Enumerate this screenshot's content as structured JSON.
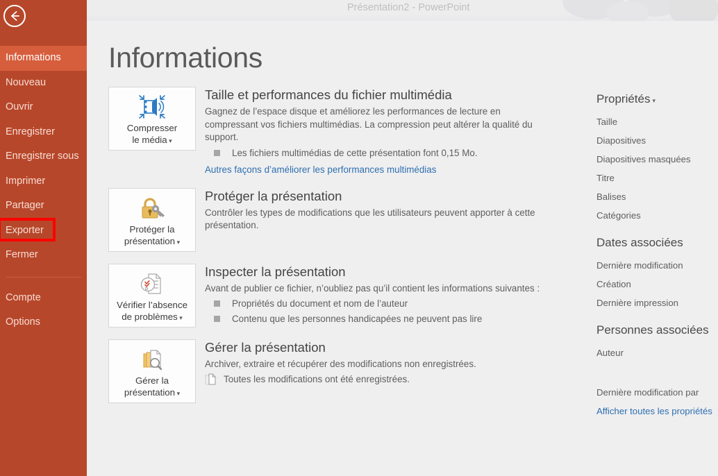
{
  "window": {
    "title": "Présentation2 - PowerPoint"
  },
  "colors": {
    "sidebar_bg": "#B7472A",
    "sidebar_active": "#D75E3D",
    "content_bg": "#EFEFF0",
    "link": "#2E6FAF",
    "highlight_box": "#FF0000"
  },
  "sidebar": {
    "back_icon": "back-arrow-icon",
    "items": [
      {
        "label": "Informations",
        "active": true
      },
      {
        "label": "Nouveau",
        "active": false
      },
      {
        "label": "Ouvrir",
        "active": false
      },
      {
        "label": "Enregistrer",
        "active": false
      },
      {
        "label": "Enregistrer sous",
        "active": false
      },
      {
        "label": "Imprimer",
        "active": false
      },
      {
        "label": "Partager",
        "active": false
      },
      {
        "label": "Exporter",
        "active": false
      },
      {
        "label": "Fermer",
        "active": false
      }
    ],
    "footer_items": [
      {
        "label": "Compte"
      },
      {
        "label": "Options"
      }
    ],
    "highlighted_item": "Exporter"
  },
  "main": {
    "page_title": "Informations",
    "blocks": [
      {
        "button_label_line1": "Compresser",
        "button_label_line2": "le média",
        "button_has_caret": true,
        "button_icon": "compress-media-icon",
        "heading": "Taille et performances du fichier multimédia",
        "description": "Gagnez de l’espace disque et améliorez les performances de lecture en compressant vos fichiers multimédias. La compression peut altérer la qualité du support.",
        "bullets": [
          "Les fichiers multimédias de cette présentation font 0,15 Mo."
        ],
        "link": "Autres façons d’améliorer les performances multimédias"
      },
      {
        "button_label_line1": "Protéger la",
        "button_label_line2": "présentation",
        "button_has_caret": true,
        "button_icon": "lock-key-icon",
        "heading": "Protéger la présentation",
        "description": "Contrôler les types de modifications que les utilisateurs peuvent apporter à cette présentation.",
        "bullets": [],
        "link": ""
      },
      {
        "button_label_line1": "Vérifier l’absence",
        "button_label_line2": "de problèmes",
        "button_has_caret": true,
        "button_icon": "inspect-document-icon",
        "heading": "Inspecter la présentation",
        "description": "Avant de publier ce fichier, n’oubliez pas qu’il contient les informations suivantes :",
        "bullets": [
          "Propriétés du document et nom de l’auteur",
          "Contenu que les personnes handicapées ne peuvent pas lire"
        ],
        "link": ""
      },
      {
        "button_label_line1": "Gérer la",
        "button_label_line2": "présentation",
        "button_has_caret": true,
        "button_icon": "manage-versions-icon",
        "heading": "Gérer la présentation",
        "description": "Archiver, extraire et récupérer des modifications non enregistrées.",
        "doc_bullets": [
          "Toutes les modifications ont été enregistrées."
        ],
        "bullets": [],
        "link": ""
      }
    ]
  },
  "properties_panel": {
    "groups": [
      {
        "title": "Propriétés",
        "has_caret": true,
        "rows": [
          "Taille",
          "Diapositives",
          "Diapositives masquées",
          "Titre",
          "Balises",
          "Catégories"
        ]
      },
      {
        "title": "Dates associées",
        "has_caret": false,
        "rows": [
          "Dernière modification",
          "Création",
          "Dernière impression"
        ]
      },
      {
        "title": "Personnes associées",
        "has_caret": false,
        "rows": [
          "Auteur"
        ]
      }
    ],
    "modified_by_label": "Dernière modification par",
    "show_all_link": "Afficher toutes les propriétés"
  }
}
